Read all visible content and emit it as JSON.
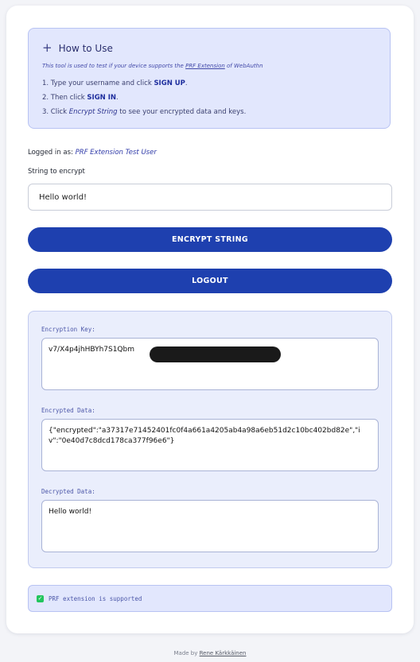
{
  "howto": {
    "title": "How to Use",
    "desc_prefix": "This tool is used to test if your device supports the ",
    "desc_link": "PRF Extension",
    "desc_suffix": " of WebAuthn",
    "steps": [
      {
        "prefix": "1. Type your username and click ",
        "strong": "SIGN UP",
        "suffix": "."
      },
      {
        "prefix": "2. Then click ",
        "strong": "SIGN IN",
        "suffix": "."
      },
      {
        "prefix": "3. Click ",
        "em": "Encrypt String",
        "suffix": " to see your encrypted data and keys."
      }
    ]
  },
  "session": {
    "logged_label": "Logged in as: ",
    "user": "PRF Extension Test User"
  },
  "form": {
    "label": "String to encrypt",
    "value": "Hello world!"
  },
  "buttons": {
    "encrypt": "ENCRYPT STRING",
    "logout": "LOGOUT"
  },
  "results": {
    "key_label": "Encryption Key:",
    "key_value": "v7/X4p4jhHBYh7S1Qbm",
    "enc_label": "Encrypted Data:",
    "enc_value": "{\"encrypted\":\"a37317e71452401fc0f4a661a4205ab4a98a6eb51d2c10bc402bd82e\",\"iv\":\"0e40d7c8dcd178ca377f96e6\"}",
    "dec_label": "Decrypted Data:",
    "dec_value": "Hello world!"
  },
  "status": {
    "prf": "PRF extension is supported"
  },
  "footer": {
    "prefix": "Made by ",
    "author": "Rene Kärkkäinen"
  },
  "colors": {
    "primary": "#1e40af",
    "panel": "#e2e7fd",
    "success": "#22c55e"
  }
}
